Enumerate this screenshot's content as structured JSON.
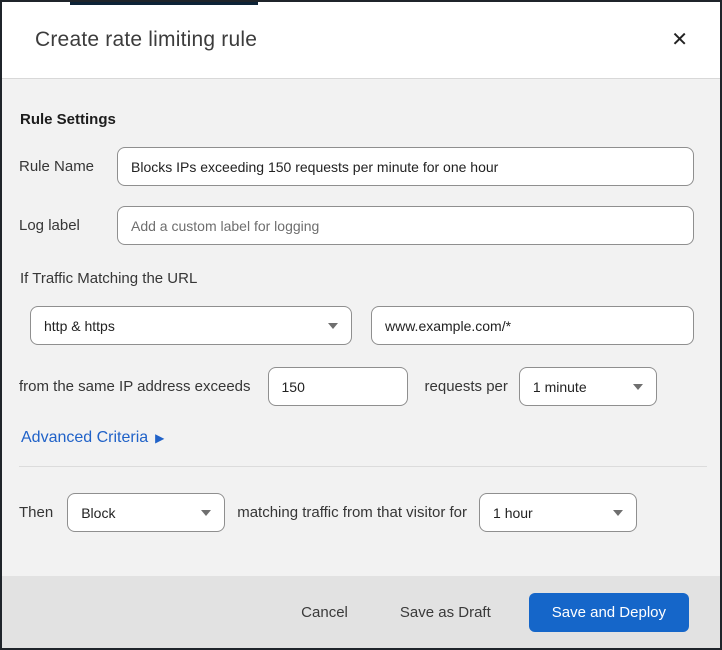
{
  "dialog": {
    "title": "Create rate limiting rule"
  },
  "icons": {
    "close": "✕",
    "advanced_arrow": "▶"
  },
  "form": {
    "section_heading": "Rule Settings",
    "rule_name": {
      "label": "Rule Name",
      "value": "Blocks IPs exceeding 150 requests per minute for one hour"
    },
    "log_label": {
      "label": "Log label",
      "placeholder": "Add a custom label for logging"
    },
    "traffic_match": {
      "intro": "If Traffic Matching the URL",
      "scheme_selected": "http & https",
      "url_value": "www.example.com/*",
      "threshold_prefix": "from the same IP address exceeds",
      "threshold_value": "150",
      "threshold_suffix": "requests per",
      "period_selected": "1 minute"
    },
    "advanced_criteria_label": "Advanced Criteria",
    "action": {
      "then_label": "Then",
      "action_selected": "Block",
      "middle_text": "matching traffic from that visitor for",
      "duration_selected": "1 hour"
    }
  },
  "footer": {
    "cancel_label": "Cancel",
    "save_draft_label": "Save as Draft",
    "save_deploy_label": "Save and Deploy"
  },
  "colors": {
    "primary_button": "#1566c9",
    "link_blue": "#2062c8",
    "top_accent": "#0d2337"
  }
}
